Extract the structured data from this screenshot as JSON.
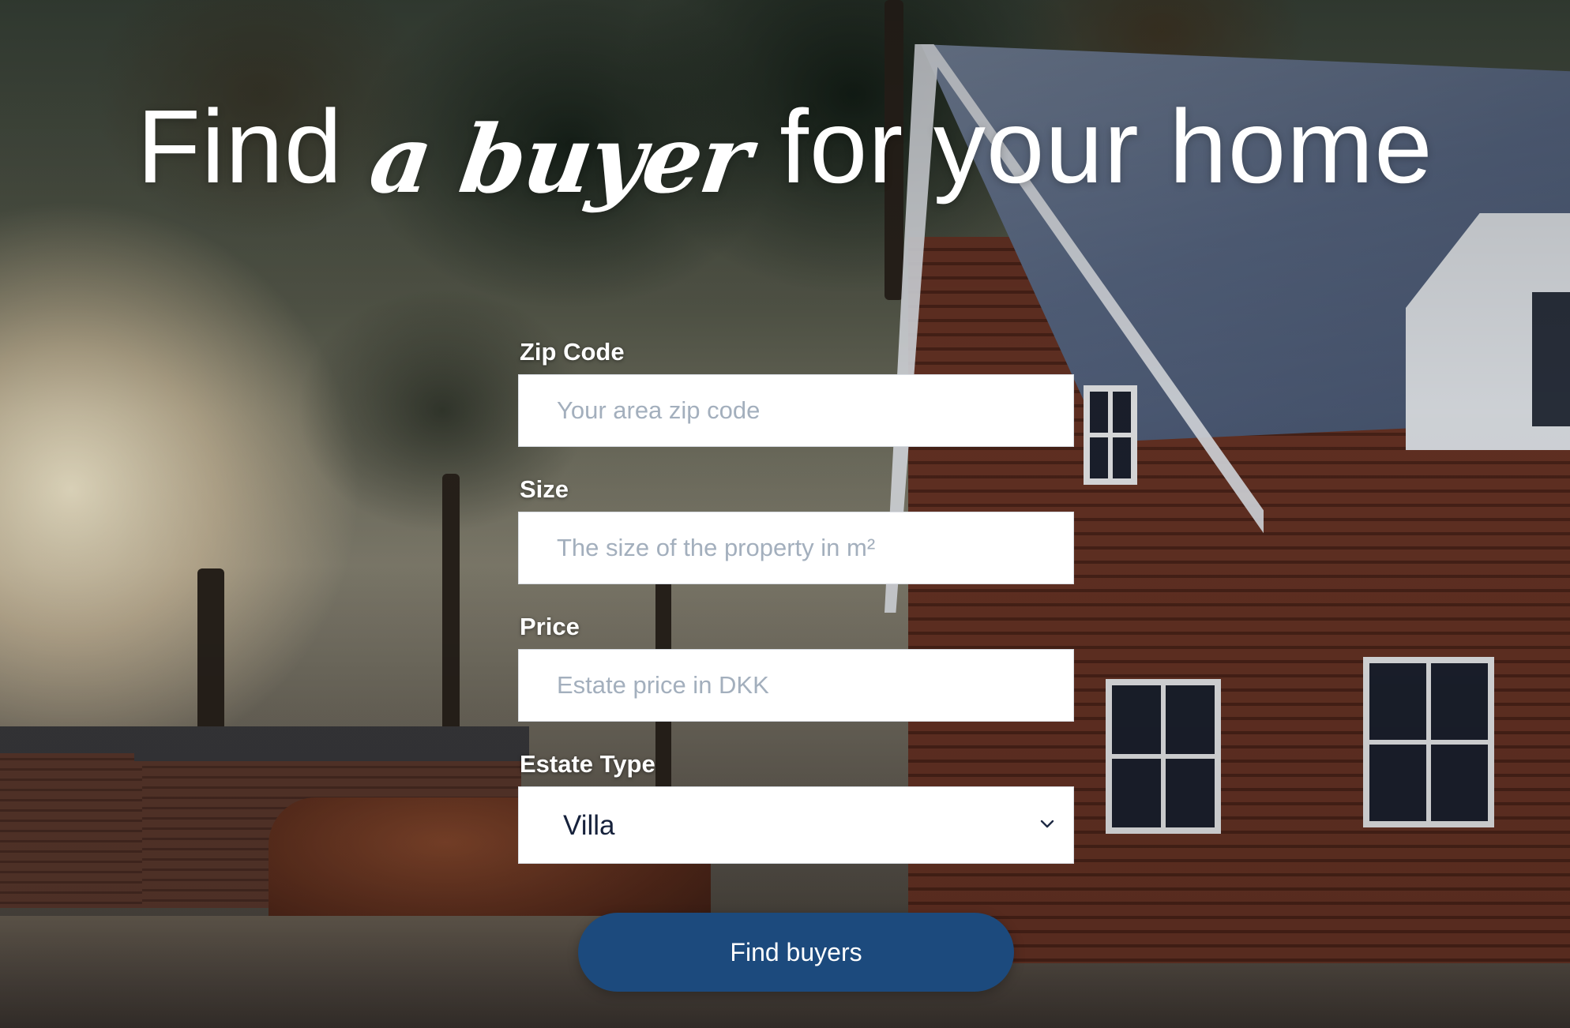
{
  "hero": {
    "headline_part1": "Find",
    "headline_script": "a buyer",
    "headline_part2": "for your home",
    "text_color": "#ffffff"
  },
  "form": {
    "zip": {
      "label": "Zip Code",
      "placeholder": "Your area zip code"
    },
    "size": {
      "label": "Size",
      "placeholder": "The size of the property in m²"
    },
    "price": {
      "label": "Price",
      "placeholder": "Estate price in DKK"
    },
    "estate_type": {
      "label": "Estate Type",
      "selected": "Villa"
    },
    "submit_label": "Find buyers",
    "button_color": "#1c4a7d"
  },
  "icons": {
    "select_arrow": "chevron-down-icon"
  }
}
